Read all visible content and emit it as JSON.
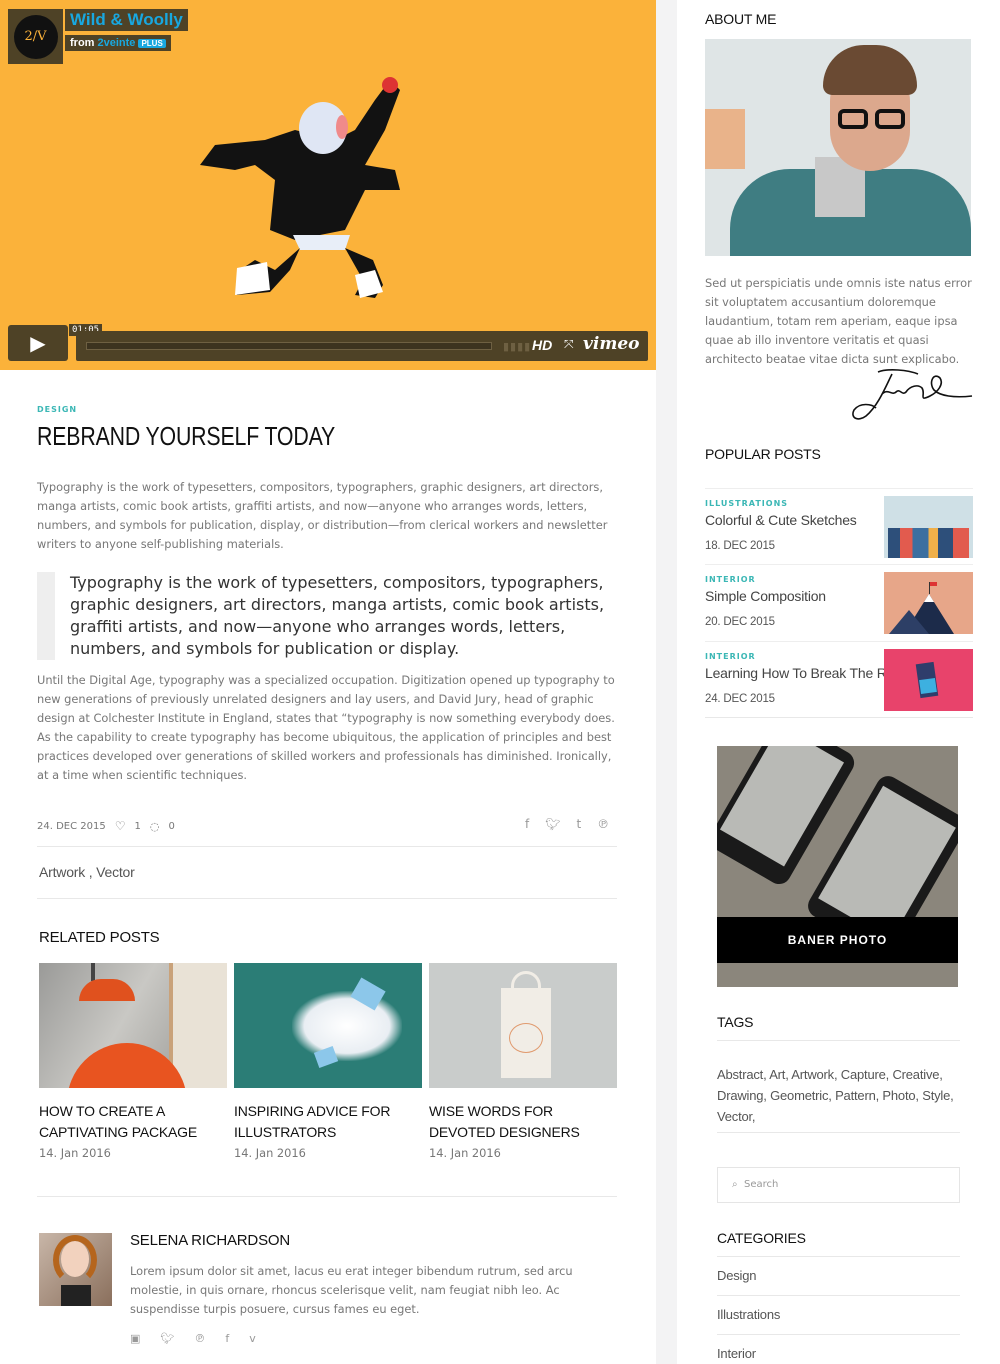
{
  "video": {
    "logo_text": "2/V",
    "title": "Wild & Woolly",
    "from_label": "from",
    "channel": "2veinte",
    "badge": "PLUS",
    "time": "01:05",
    "hd": "HD",
    "brand": "vimeo"
  },
  "article": {
    "category": "DESIGN",
    "title": "REBRAND YOURSELF TODAY",
    "paragraph1": "Typography is the work of typesetters, compositors, typographers, graphic designers, art directors, manga artists, comic book artists, graffiti artists, and now—anyone who arranges words, letters, numbers, and symbols for publication, display, or distribution—from clerical workers and newsletter writers to anyone self-publishing materials.",
    "quote": "Typography is the work of typesetters, compositors, typographers, graphic designers, art directors, manga artists, comic book artists, graffiti artists, and now—anyone who arranges words, letters, numbers, and symbols for publication or display.",
    "paragraph2": "Until the Digital Age, typography was a specialized occupation. Digitization opened up typography to new generations of previously unrelated designers and lay users, and David Jury, head of graphic design at Colchester Institute in England, states that “typography is now something everybody does. As the capability to create typography has become ubiquitous, the application of principles and best practices developed over generations of skilled workers and professionals has diminished. Ironically, at a time when scientific techniques.",
    "date": "24. DEC 2015",
    "likes": "1",
    "comments": "0",
    "tags": "Artwork ,  Vector"
  },
  "related": {
    "heading": "RELATED POSTS",
    "posts": [
      {
        "title": "HOW TO CREATE A CAPTIVATING PACKAGE",
        "date": "14. Jan 2016"
      },
      {
        "title": "INSPIRING ADVICE FOR ILLUSTRATORS",
        "date": "14. Jan 2016"
      },
      {
        "title": "WISE WORDS FOR DEVOTED DESIGNERS",
        "date": "14. Jan 2016"
      }
    ]
  },
  "author": {
    "name": "SELENA RICHARDSON",
    "bio": "Lorem ipsum dolor sit amet, lacus eu erat integer bibendum rutrum, sed arcu molestie, in quis ornare, rhoncus scelerisque velit, nam feugiat nibh leo. Ac suspendisse turpis posuere, cursus fames eu eget."
  },
  "sidebar": {
    "about_heading": "ABOUT ME",
    "about_text": "Sed ut perspiciatis unde omnis iste natus error sit voluptatem accusantium doloremque laudantium, totam rem aperiam, eaque ipsa quae ab illo inventore veritatis et quasi architecto beatae vitae dicta sunt explicabo.",
    "popular_heading": "POPULAR POSTS",
    "popular": [
      {
        "category": "ILLUSTRATIONS",
        "title": "Colorful & Cute Sketches",
        "date": "18. DEC 2015"
      },
      {
        "category": "INTERIOR",
        "title": "Simple Composition",
        "date": "20. DEC 2015"
      },
      {
        "category": "INTERIOR",
        "title": "Learning How To Break The Rules",
        "date": "24. DEC 2015"
      }
    ],
    "banner_label": "BANER PHOTO",
    "tags_heading": "TAGS",
    "tags": "Abstract, Art, Artwork, Capture, Creative, Drawing, Geometric, Pattern, Photo, Style, Vector,",
    "search_placeholder": "Search",
    "categories_heading": "CATEGORIES",
    "categories": [
      "Design",
      "Illustrations",
      "Interior"
    ]
  },
  "colors": {
    "accent": "#3bb7b5",
    "video_bg": "#fbb23a",
    "vimeo_blue": "#18a8e0"
  }
}
